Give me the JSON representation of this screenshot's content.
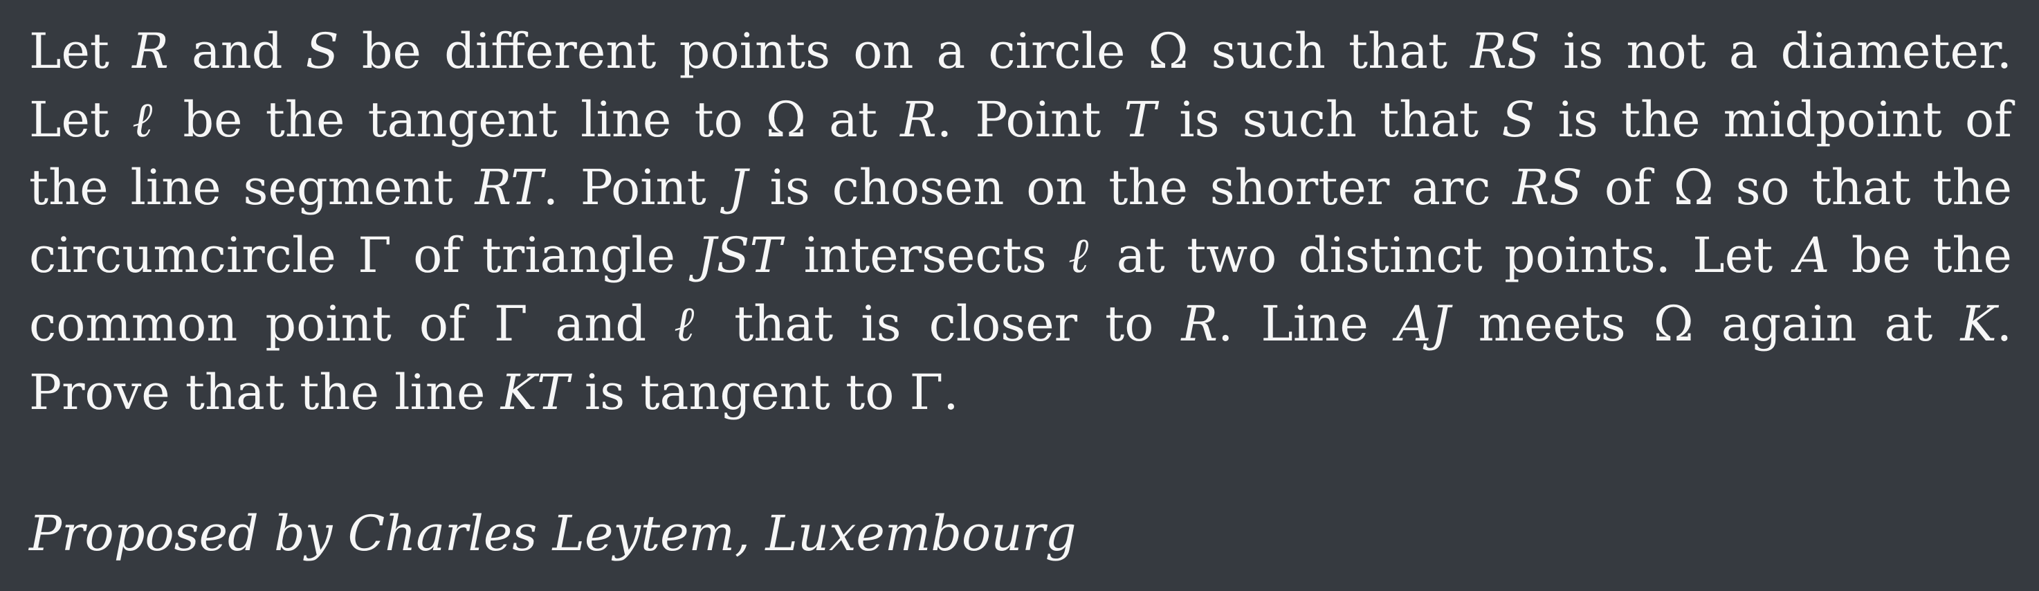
{
  "problem": {
    "lines": [
      [
        "Let ",
        "R",
        " and ",
        "S",
        " be different points on a circle Ω such that ",
        "RS",
        " is not a diameter."
      ],
      [
        "Let ",
        "ℓ",
        " be the tangent line to Ω at ",
        "R",
        ". Point ",
        "T",
        " is such that ",
        "S",
        " is the midpoint of"
      ],
      [
        "the line segment ",
        "RT",
        ". Point ",
        "J",
        " is chosen on the shorter arc ",
        "RS",
        " of Ω so that the"
      ],
      [
        "circumcircle Γ of triangle ",
        "JST",
        " intersects ",
        "ℓ",
        " at two distinct points. Let ",
        "A",
        " be the"
      ],
      [
        "common point of Γ and ",
        "ℓ",
        " that is closer to ",
        "R",
        ". Line ",
        "AJ",
        " meets Ω again at ",
        "K",
        "."
      ],
      [
        "Prove that the line ",
        "KT",
        " is tangent to Γ."
      ]
    ]
  },
  "credit": "Proposed by Charles Leytem, Luxembourg"
}
